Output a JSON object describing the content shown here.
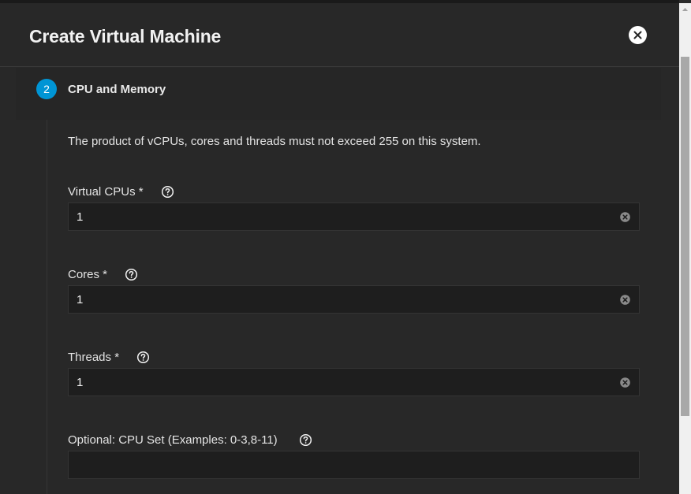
{
  "dialog": {
    "title": "Create Virtual Machine"
  },
  "step": {
    "number": "2",
    "label": "CPU and Memory",
    "badge_color": "#0095d5"
  },
  "help_text": "The product of vCPUs, cores and threads must not exceed 255 on this system.",
  "fields": {
    "vcpus": {
      "label": "Virtual CPUs *",
      "value": "1"
    },
    "cores": {
      "label": "Cores *",
      "value": "1"
    },
    "threads": {
      "label": "Threads *",
      "value": "1"
    },
    "cpu_set": {
      "label": "Optional: CPU Set (Examples: 0-3,8-11)",
      "value": ""
    }
  },
  "icons": {
    "close": "close-icon",
    "help": "help-circle-icon",
    "clear": "clear-circle-icon"
  }
}
